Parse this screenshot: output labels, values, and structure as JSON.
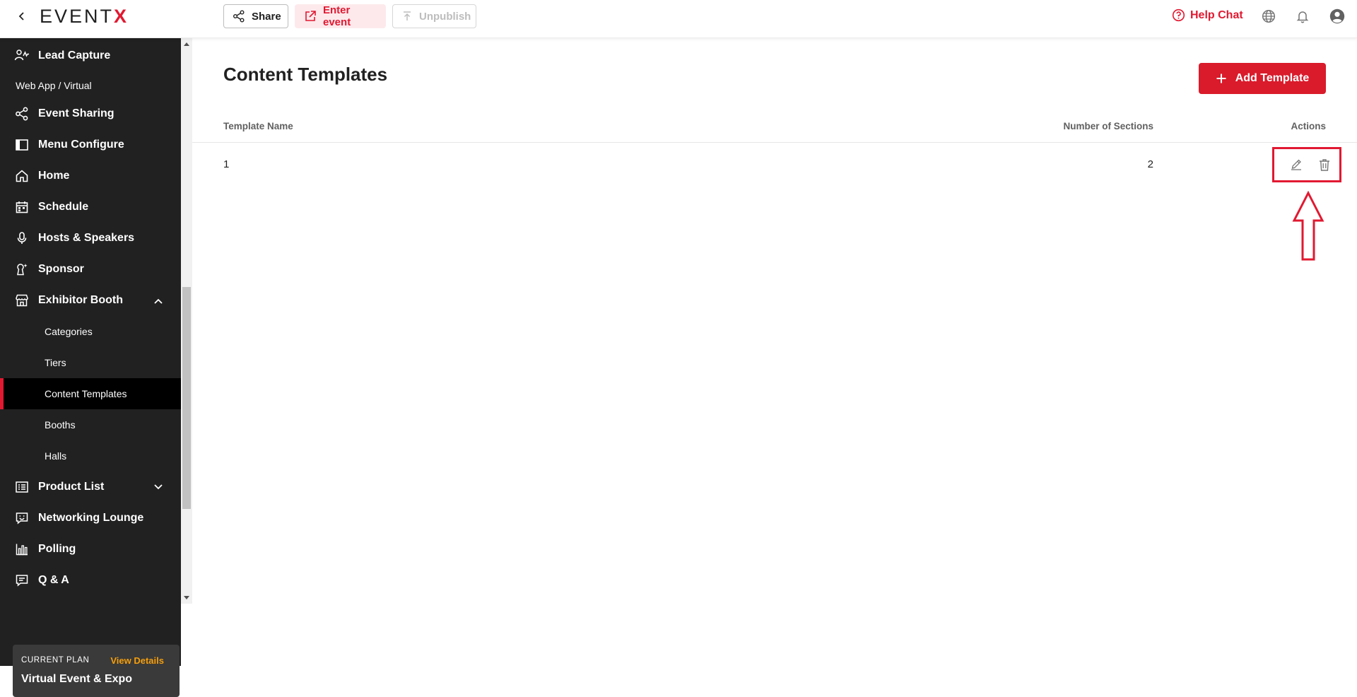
{
  "header": {
    "logo_text": "EVENT",
    "logo_accent": "X",
    "share_label": "Share",
    "enter_event_label": "Enter event",
    "unpublish_label": "Unpublish",
    "help_chat_label": "Help Chat",
    "icons": [
      "back-icon",
      "share-icon",
      "external-link-icon",
      "upload-icon",
      "help-circle-icon",
      "globe-icon",
      "bell-icon",
      "user-avatar-icon"
    ]
  },
  "sidebar": {
    "items": [
      {
        "label": "Lead Capture",
        "icon": "lead-capture-icon"
      },
      {
        "label": "Web App / Virtual",
        "type": "section"
      },
      {
        "label": "Event Sharing",
        "icon": "share-icon"
      },
      {
        "label": "Menu Configure",
        "icon": "menu-configure-icon"
      },
      {
        "label": "Home",
        "icon": "home-icon"
      },
      {
        "label": "Schedule",
        "icon": "calendar-icon"
      },
      {
        "label": "Hosts & Speakers",
        "icon": "microphone-icon"
      },
      {
        "label": "Sponsor",
        "icon": "sponsor-icon"
      },
      {
        "label": "Exhibitor Booth",
        "icon": "store-icon",
        "expanded": true
      },
      {
        "label": "Categories",
        "type": "sub"
      },
      {
        "label": "Tiers",
        "type": "sub"
      },
      {
        "label": "Content Templates",
        "type": "sub",
        "active": true
      },
      {
        "label": "Booths",
        "type": "sub"
      },
      {
        "label": "Halls",
        "type": "sub"
      },
      {
        "label": "Product List",
        "icon": "list-icon",
        "expanded": false
      },
      {
        "label": "Networking Lounge",
        "icon": "chat-smile-icon"
      },
      {
        "label": "Polling",
        "icon": "bar-chart-icon"
      },
      {
        "label": "Q & A",
        "icon": "message-icon"
      }
    ],
    "plan": {
      "caption": "CURRENT PLAN",
      "view_details": "View Details",
      "name": "Virtual Event & Expo"
    }
  },
  "main": {
    "title": "Content Templates",
    "add_button_label": "Add Template",
    "table": {
      "columns": [
        "Template Name",
        "Number of Sections",
        "Actions"
      ],
      "rows": [
        {
          "name": "1",
          "sections": "2",
          "actions": [
            "edit-icon",
            "trash-icon"
          ]
        }
      ]
    }
  },
  "colors": {
    "brand_red": "#e11931",
    "button_red": "#d91b2b",
    "sidebar_bg": "#212121",
    "plan_link": "#f59e0b"
  }
}
